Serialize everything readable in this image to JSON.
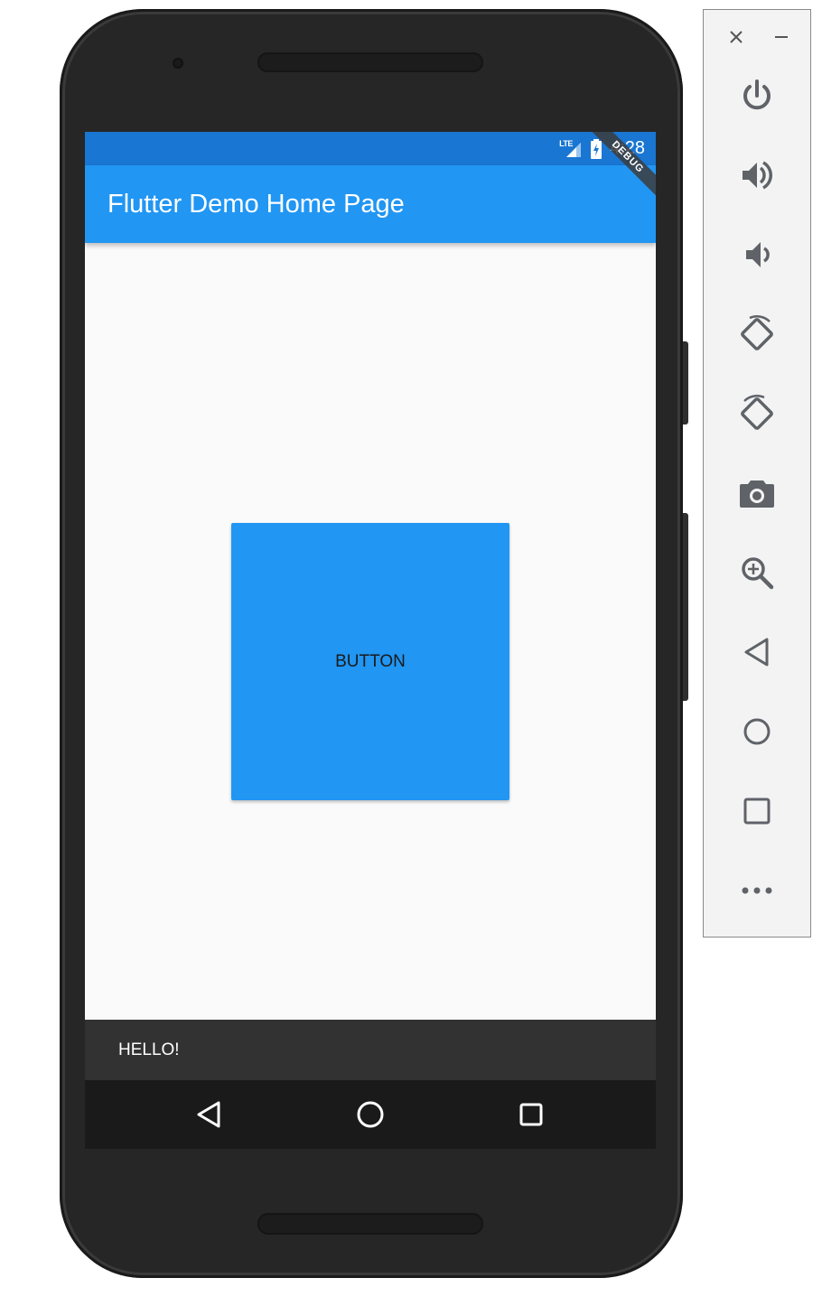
{
  "status_bar": {
    "network": "LTE",
    "time": "4:28"
  },
  "app_bar": {
    "title": "Flutter Demo Home Page",
    "debug_banner": "DEBUG"
  },
  "main": {
    "button_label": "BUTTON"
  },
  "snackbar": {
    "message": "HELLO!"
  },
  "nav_bar": {
    "icons": [
      "back-icon",
      "home-icon",
      "recents-icon"
    ]
  },
  "emulator_toolbar": {
    "window_controls": [
      "close-icon",
      "minimize-icon"
    ],
    "buttons": [
      "power-icon",
      "volume-up-icon",
      "volume-down-icon",
      "rotate-left-icon",
      "rotate-right-icon",
      "camera-icon",
      "zoom-icon",
      "back-icon",
      "home-icon",
      "overview-icon",
      "more-icon"
    ]
  },
  "colors": {
    "status_bar": "#1976d2",
    "app_bar": "#2196f3",
    "button": "#2196f3",
    "snackbar": "#323232",
    "nav_bar": "#1a1a1a",
    "screen_bg": "#fafafa"
  }
}
